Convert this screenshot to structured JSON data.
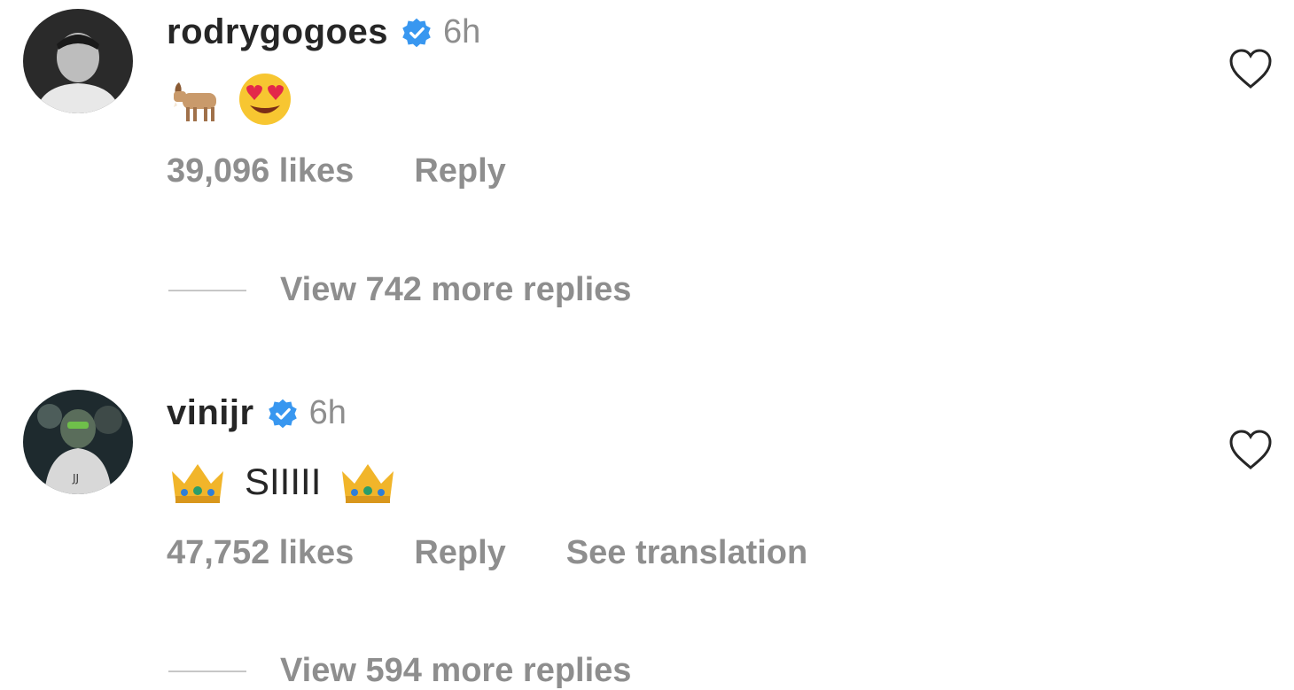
{
  "comments": [
    {
      "username": "rodrygogoes",
      "time": "6h",
      "text": "",
      "emojis": [
        "goat",
        "heart-eyes"
      ],
      "likes": "39,096 likes",
      "reply_label": "Reply",
      "view_replies": "View 742 more replies"
    },
    {
      "username": "vinijr",
      "time": "6h",
      "text": "SIIIII",
      "emojis": [
        "crown",
        "crown"
      ],
      "likes": "47,752 likes",
      "reply_label": "Reply",
      "translate_label": "See translation",
      "view_replies": "View 594 more replies"
    }
  ],
  "colors": {
    "text_primary": "#262626",
    "text_secondary": "#8e8e8e",
    "verified_blue": "#3897f0",
    "divider": "#c7c7c7"
  },
  "icons": [
    "verified-badge-icon",
    "heart-outline-icon",
    "goat-emoji",
    "heart-eyes-emoji",
    "crown-emoji"
  ]
}
